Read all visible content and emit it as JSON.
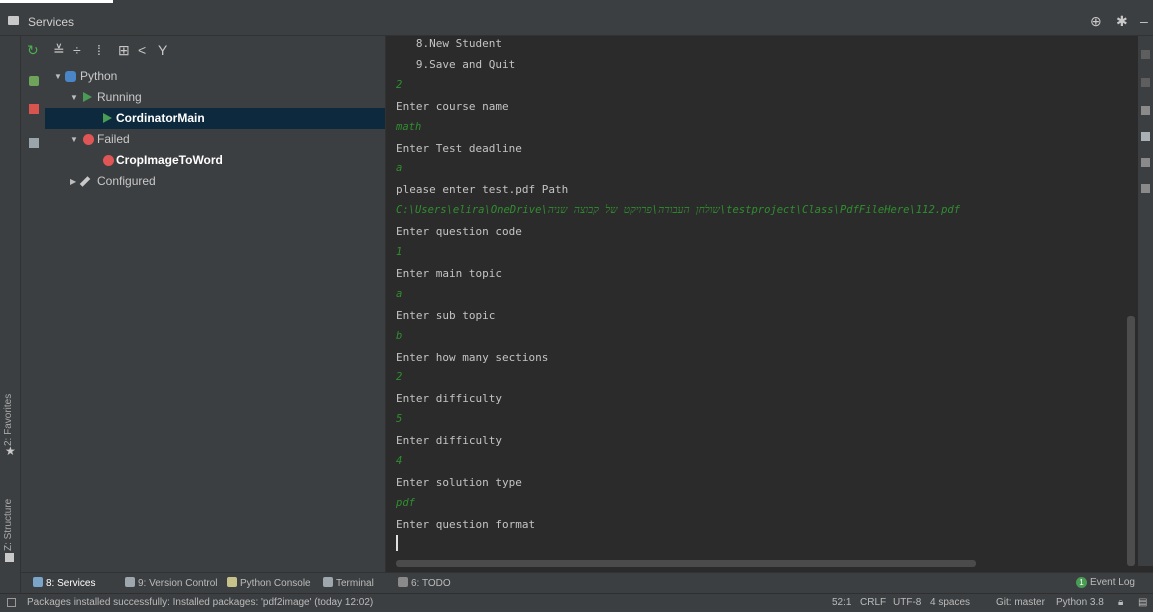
{
  "header": {
    "title": "Services"
  },
  "left_stripe": {
    "favorites": "2: Favorites",
    "structure": "Z: Structure"
  },
  "tree": {
    "python": "Python",
    "running": "Running",
    "cordinator": "CordinatorMain",
    "failed": "Failed",
    "crop": "CropImageToWord",
    "configured": "Configured"
  },
  "console": {
    "lines": [
      {
        "text": "   8.New Student",
        "type": "out"
      },
      {
        "text": "   9.Save and Quit",
        "type": "out"
      },
      {
        "text": "2",
        "type": "in"
      },
      {
        "text": "Enter course name",
        "type": "out"
      },
      {
        "text": "math",
        "type": "in"
      },
      {
        "text": "Enter Test deadline",
        "type": "out"
      },
      {
        "text": "a",
        "type": "in"
      },
      {
        "text": "please enter test.pdf Path",
        "type": "out"
      },
      {
        "text": "C:\\Users\\elira\\OneDrive\\שולחן העבודה\\פרויקט של קבוצה שניה\\testproject\\Class\\PdfFileHere\\112.pdf",
        "type": "in"
      },
      {
        "text": "Enter question code",
        "type": "out"
      },
      {
        "text": "1",
        "type": "in"
      },
      {
        "text": "Enter main topic",
        "type": "out"
      },
      {
        "text": "a",
        "type": "in"
      },
      {
        "text": "Enter sub topic",
        "type": "out"
      },
      {
        "text": "b",
        "type": "in"
      },
      {
        "text": "Enter how many sections",
        "type": "out"
      },
      {
        "text": "2",
        "type": "in"
      },
      {
        "text": "Enter difficulty",
        "type": "out"
      },
      {
        "text": "5",
        "type": "in"
      },
      {
        "text": "Enter difficulty",
        "type": "out"
      },
      {
        "text": "4",
        "type": "in"
      },
      {
        "text": "Enter solution type",
        "type": "out"
      },
      {
        "text": "pdf",
        "type": "in"
      },
      {
        "text": "Enter question format",
        "type": "out"
      }
    ]
  },
  "bottom_tabs": {
    "services": "8: Services",
    "version_control": "9: Version Control",
    "python_console": "Python Console",
    "terminal": "Terminal",
    "todo": "6: TODO",
    "event_log": "Event Log",
    "event_count": "1"
  },
  "status": {
    "message": "Packages installed successfully: Installed packages: 'pdf2image' (today 12:02)",
    "position": "52:1",
    "line_sep": "CRLF",
    "encoding": "UTF-8",
    "indent": "4 spaces",
    "git": "Git: master",
    "interpreter": "Python 3.8"
  },
  "colors": {
    "background": "#2b2b2b",
    "panel": "#3c3f41",
    "selection": "#0d293e",
    "input_text": "#2f8f2f",
    "run_green": "#499c54",
    "fail_red": "#e05555"
  }
}
